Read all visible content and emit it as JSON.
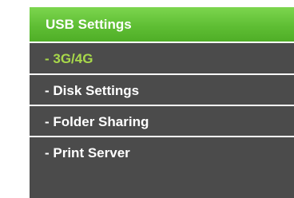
{
  "menu": {
    "header_label": "USB Settings",
    "items": [
      {
        "label": "- 3G/4G",
        "active": true
      },
      {
        "label": "- Disk Settings",
        "active": false
      },
      {
        "label": "- Folder Sharing",
        "active": false
      },
      {
        "label": "- Print Server",
        "active": false
      }
    ]
  },
  "colors": {
    "header_green": "#5fbe34",
    "item_background": "#4b4b4b",
    "active_text": "#a8d84a",
    "item_text": "#ffffff"
  }
}
